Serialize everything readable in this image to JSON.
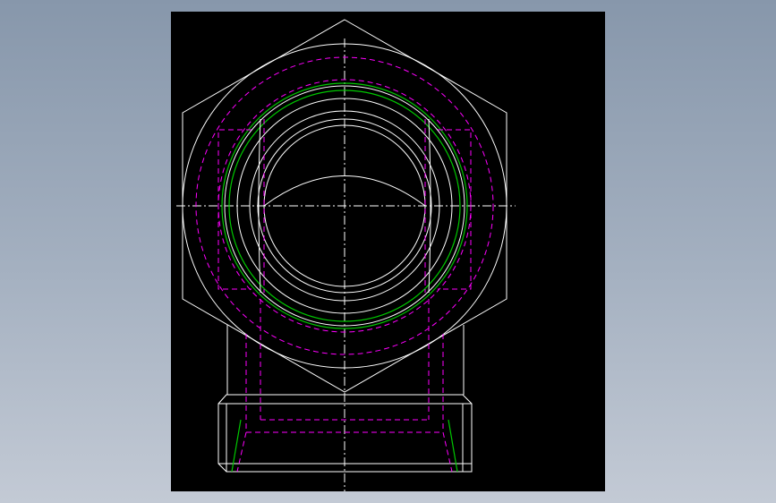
{
  "viewport": {
    "background_top": "#8797ab",
    "background_bottom": "#c3cad5"
  },
  "drawing": {
    "canvas_color": "#000000",
    "line_colors": {
      "visible": "#ffffff",
      "hidden": "#ff00ff",
      "thread": "#00c800",
      "center": "#ffffff"
    },
    "views": [
      "top-view-hex-fitting",
      "front-view-body"
    ]
  }
}
